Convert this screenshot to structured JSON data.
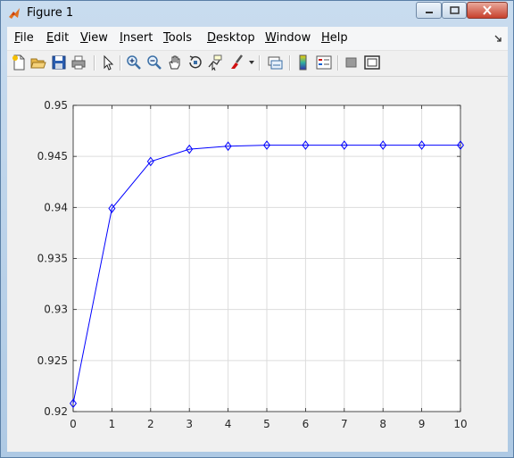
{
  "window": {
    "title": "Figure 1",
    "icon": "matlab-icon",
    "controls": [
      "minimize-icon",
      "maximize-icon",
      "close-icon"
    ]
  },
  "menubar": {
    "items": [
      {
        "label": "File",
        "u": "F",
        "rest": "ile"
      },
      {
        "label": "Edit",
        "u": "E",
        "rest": "dit"
      },
      {
        "label": "View",
        "u": "V",
        "rest": "iew"
      },
      {
        "label": "Insert",
        "u": "I",
        "rest": "nsert"
      },
      {
        "label": "Tools",
        "u": "T",
        "rest": "ools"
      },
      {
        "label": "Desktop",
        "u": "D",
        "rest": "esktop"
      },
      {
        "label": "Window",
        "u": "W",
        "rest": "indow"
      },
      {
        "label": "Help",
        "u": "H",
        "rest": "elp"
      }
    ]
  },
  "toolbar": {
    "icons": [
      "new-figure-icon",
      "open-file-icon",
      "save-icon",
      "print-icon",
      "edit-plot-arrow-icon",
      "zoom-in-icon",
      "zoom-out-icon",
      "pan-icon",
      "rotate-3d-icon",
      "data-cursor-icon",
      "brush-icon",
      "link-plot-icon",
      "colorbar-icon",
      "legend-icon",
      "hide-plot-tools-icon",
      "show-plot-tools-icon"
    ]
  },
  "chart_data": {
    "type": "line",
    "title": "",
    "xlabel": "",
    "ylabel": "",
    "x": [
      0,
      1,
      2,
      3,
      4,
      5,
      6,
      7,
      8,
      9,
      10
    ],
    "series": [
      {
        "values": [
          0.9208,
          0.9399,
          0.9445,
          0.9457,
          0.946,
          0.9461,
          0.9461,
          0.9461,
          0.9461,
          0.9461,
          0.9461
        ],
        "color": "#0000ff",
        "marker": "diamond"
      }
    ],
    "xlim": [
      0,
      10
    ],
    "ylim": [
      0.92,
      0.95
    ],
    "xticks": [
      "0",
      "1",
      "2",
      "3",
      "4",
      "5",
      "6",
      "7",
      "8",
      "9",
      "10"
    ],
    "yticks": [
      "0.92",
      "0.925",
      "0.93",
      "0.935",
      "0.94",
      "0.945",
      "0.95"
    ],
    "grid": true,
    "legend": "none"
  }
}
